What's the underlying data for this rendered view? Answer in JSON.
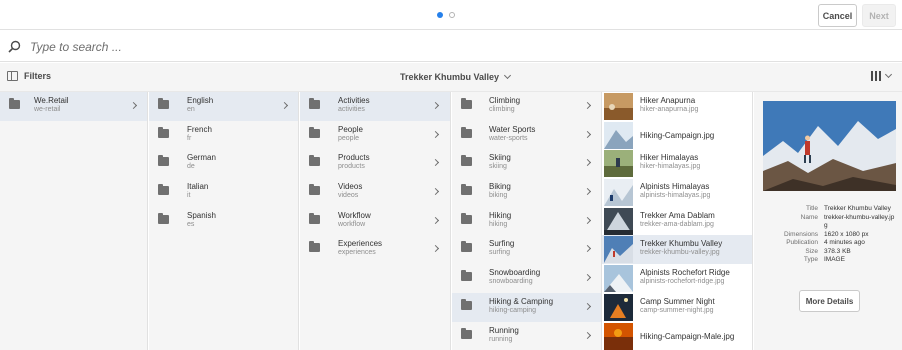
{
  "wizard": {
    "steps": [
      {
        "state": "active"
      },
      {
        "state": "inactive"
      }
    ],
    "cancel_label": "Cancel",
    "next_label": "Next"
  },
  "search": {
    "placeholder": "Type to search ..."
  },
  "toolbar": {
    "filters_label": "Filters",
    "current_folder": "Trekker Khumbu Valley",
    "view_icon": "column-view-icon"
  },
  "columns": [
    {
      "items": [
        {
          "title": "We.Retail",
          "name": "we-retail",
          "selected": true
        }
      ]
    },
    {
      "items": [
        {
          "title": "English",
          "name": "en",
          "selected": true
        },
        {
          "title": "French",
          "name": "fr"
        },
        {
          "title": "German",
          "name": "de"
        },
        {
          "title": "Italian",
          "name": "it"
        },
        {
          "title": "Spanish",
          "name": "es"
        }
      ]
    },
    {
      "items": [
        {
          "title": "Activities",
          "name": "activities",
          "selected": true
        },
        {
          "title": "People",
          "name": "people"
        },
        {
          "title": "Products",
          "name": "products"
        },
        {
          "title": "Videos",
          "name": "videos"
        },
        {
          "title": "Workflow",
          "name": "workflow"
        },
        {
          "title": "Experiences",
          "name": "experiences"
        }
      ]
    },
    {
      "items": [
        {
          "title": "Climbing",
          "name": "climbing"
        },
        {
          "title": "Water Sports",
          "name": "water-sports"
        },
        {
          "title": "Skiing",
          "name": "skiing"
        },
        {
          "title": "Biking",
          "name": "biking"
        },
        {
          "title": "Hiking",
          "name": "hiking"
        },
        {
          "title": "Surfing",
          "name": "surfing"
        },
        {
          "title": "Snowboarding",
          "name": "snowboarding"
        },
        {
          "title": "Hiking & Camping",
          "name": "hiking-camping",
          "selected": true
        },
        {
          "title": "Running",
          "name": "running"
        }
      ]
    }
  ],
  "assets": [
    {
      "title": "Hiker Anapurna",
      "name": "hiker-anapurna.jpg",
      "thumb": "desert"
    },
    {
      "title": "Hiking-Campaign.jpg",
      "name": "",
      "thumb": "snow"
    },
    {
      "title": "Hiker Himalayas",
      "name": "hiker-himalayas.jpg",
      "thumb": "green"
    },
    {
      "title": "Alpinists Himalayas",
      "name": "alpinists-himalayas.jpg",
      "thumb": "ice"
    },
    {
      "title": "Trekker Ama Dablam",
      "name": "trekker-ama-dablam.jpg",
      "thumb": "dark"
    },
    {
      "title": "Trekker Khumbu Valley",
      "name": "trekker-khumbu-valley.jpg",
      "thumb": "sky",
      "selected": true
    },
    {
      "title": "Alpinists Rochefort Ridge",
      "name": "alpinists-rochefort-ridge.jpg",
      "thumb": "ridge"
    },
    {
      "title": "Camp Summer Night",
      "name": "camp-summer-night.jpg",
      "thumb": "night"
    },
    {
      "title": "Hiking-Campaign-Male.jpg",
      "name": "",
      "thumb": "orange"
    }
  ],
  "preview": {
    "meta": [
      {
        "key": "Title",
        "value": "Trekker Khumbu Valley"
      },
      {
        "key": "Name",
        "value": "trekker-khumbu-valley.jpg"
      },
      {
        "key": "Dimensions",
        "value": "1620 x 1080 px"
      },
      {
        "key": "Publication",
        "value": "4 minutes ago"
      },
      {
        "key": "Size",
        "value": "378.3 KB"
      },
      {
        "key": "Type",
        "value": "IMAGE"
      }
    ],
    "more_details_label": "More Details"
  },
  "colors": {
    "accent": "#2680eb",
    "selected_row": "#e5eaf1",
    "column_bg": "#f5f5f5"
  }
}
